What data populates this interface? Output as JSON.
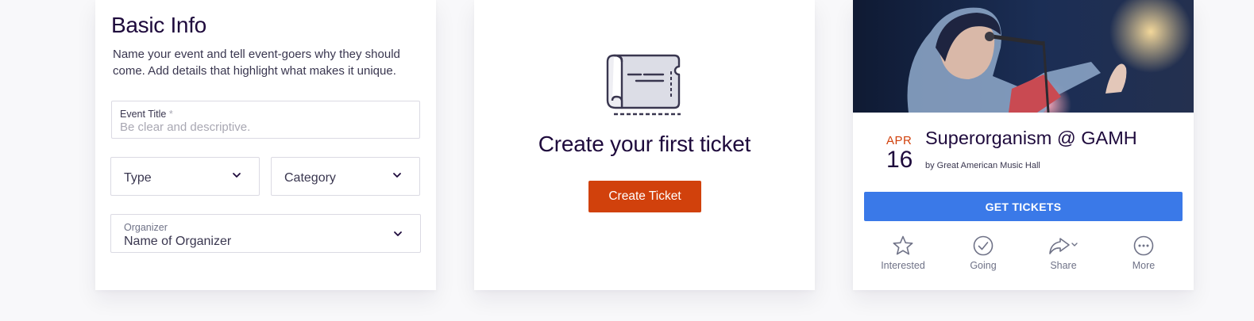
{
  "basic_info": {
    "title": "Basic Info",
    "description": "Name your event and tell event-goers why they should come. Add details that highlight what makes it unique.",
    "event_title": {
      "label": "Event Title",
      "required_mark": "*",
      "placeholder": "Be clear and descriptive.",
      "value": ""
    },
    "type_select": {
      "value": "Type"
    },
    "category_select": {
      "value": "Category"
    },
    "organizer_select": {
      "label": "Organizer",
      "value": "Name of Organizer"
    }
  },
  "ticket": {
    "heading": "Create your first ticket",
    "button_label": "Create Ticket"
  },
  "event_preview": {
    "month": "APR",
    "day": "16",
    "name": "Superorganism @ GAMH",
    "organizer": "by Great American Music Hall",
    "cta_label": "GET TICKETS",
    "actions": [
      {
        "label": "Interested",
        "icon": "star-icon"
      },
      {
        "label": "Going",
        "icon": "check-circle-icon"
      },
      {
        "label": "Share",
        "icon": "share-icon"
      },
      {
        "label": "More",
        "icon": "more-icon"
      }
    ]
  },
  "colors": {
    "brand_orange": "#d1410c",
    "primary_blue": "#3a79e8",
    "heading_navy": "#1e0a3c",
    "body_text": "#39364f",
    "muted_text": "#6f7287",
    "border": "#dbdae3"
  }
}
